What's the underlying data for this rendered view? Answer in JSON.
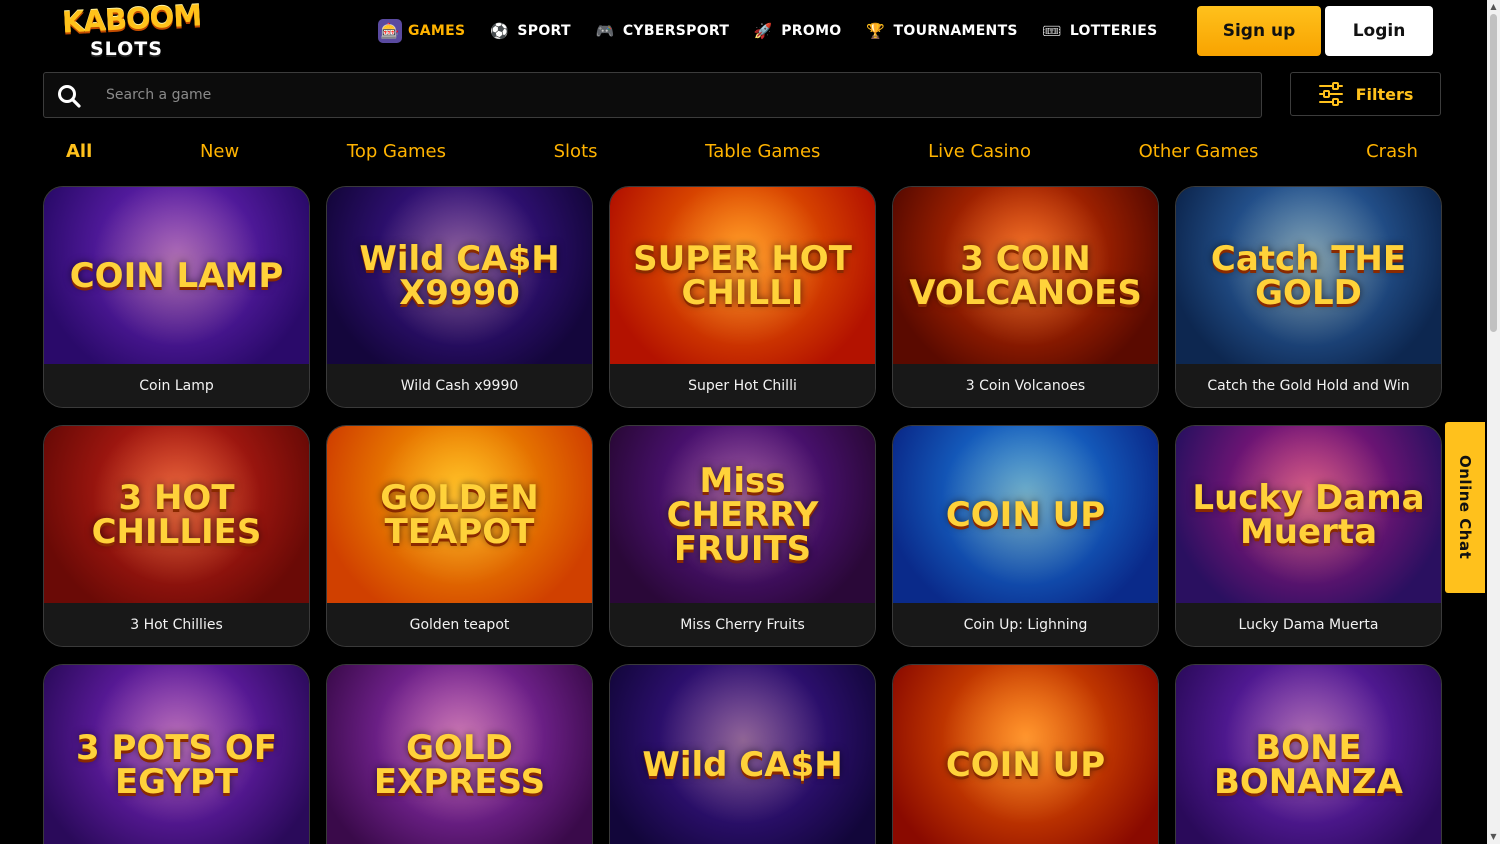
{
  "brand": {
    "line1": "KABOOM",
    "line2": "SLOTS"
  },
  "nav": [
    {
      "label": "GAMES",
      "icon": "slot-machine-icon",
      "active": true
    },
    {
      "label": "SPORT",
      "icon": "soccer-ball-icon",
      "active": false
    },
    {
      "label": "CYBERSPORT",
      "icon": "gamepad-icon",
      "active": false
    },
    {
      "label": "PROMO",
      "icon": "rocket-icon",
      "active": false
    },
    {
      "label": "TOURNAMENTS",
      "icon": "trophy-icon",
      "active": false
    },
    {
      "label": "LOTTERIES",
      "icon": "lottery-ticket-icon",
      "active": false
    }
  ],
  "auth": {
    "signup_label": "Sign up",
    "login_label": "Login"
  },
  "search": {
    "placeholder": "Search a game"
  },
  "filters": {
    "label": "Filters"
  },
  "tabs": [
    "All",
    "New",
    "Top Games",
    "Slots",
    "Table Games",
    "Live Casino",
    "Other Games",
    "Crash"
  ],
  "active_tab": "All",
  "games": [
    {
      "name": "Coin Lamp",
      "art_text": "COIN LAMP",
      "bg": [
        "#7b2bd1",
        "#2a0a6a"
      ]
    },
    {
      "name": "Wild Cash x9990",
      "art_text": "Wild CA$H X9990",
      "bg": [
        "#4a1aa8",
        "#14063c"
      ]
    },
    {
      "name": "Super Hot Chilli",
      "art_text": "SUPER HOT CHILLI",
      "bg": [
        "#ff7a00",
        "#b31200"
      ]
    },
    {
      "name": "3 Coin Volcanoes",
      "art_text": "3 COIN VOLCANOES",
      "bg": [
        "#e83a00",
        "#5a0a00"
      ]
    },
    {
      "name": "Catch the Gold Hold and Win",
      "art_text": "Catch THE GOLD",
      "bg": [
        "#3a7bc8",
        "#0d2750"
      ]
    },
    {
      "name": "3 Hot Chillies",
      "art_text": "3 HOT CHILLIES",
      "bg": [
        "#d6241a",
        "#6a0a06"
      ]
    },
    {
      "name": "Golden teapot",
      "art_text": "GOLDEN TEAPOT",
      "bg": [
        "#ffb000",
        "#d04000"
      ]
    },
    {
      "name": "Miss Cherry Fruits",
      "art_text": "Miss CHERRY FRUITS",
      "bg": [
        "#6a1aa8",
        "#2a0838"
      ]
    },
    {
      "name": "Coin Up: Lighning",
      "art_text": "COIN UP",
      "bg": [
        "#1f8ff0",
        "#0a2a8a"
      ]
    },
    {
      "name": "Lucky Dama Muerta",
      "art_text": "Lucky Dama Muerta",
      "bg": [
        "#b81a8a",
        "#2a1060"
      ]
    },
    {
      "name": "",
      "art_text": "3 POTS OF EGYPT",
      "bg": [
        "#8a2ad8",
        "#2a0a5a"
      ]
    },
    {
      "name": "",
      "art_text": "GOLD EXPRESS",
      "bg": [
        "#a83ad0",
        "#3a0a4a"
      ]
    },
    {
      "name": "",
      "art_text": "Wild CA$H",
      "bg": [
        "#4a1aa8",
        "#12063a"
      ]
    },
    {
      "name": "",
      "art_text": "COIN UP",
      "bg": [
        "#ff6a00",
        "#8a0a00"
      ]
    },
    {
      "name": "",
      "art_text": "BONE BONANZA",
      "bg": [
        "#7a2ad0",
        "#2a0a5a"
      ]
    }
  ],
  "chat": {
    "label": "Online Chat"
  },
  "colors": {
    "accent": "#ffc11c",
    "background": "#000000",
    "card_bg": "#181818"
  }
}
